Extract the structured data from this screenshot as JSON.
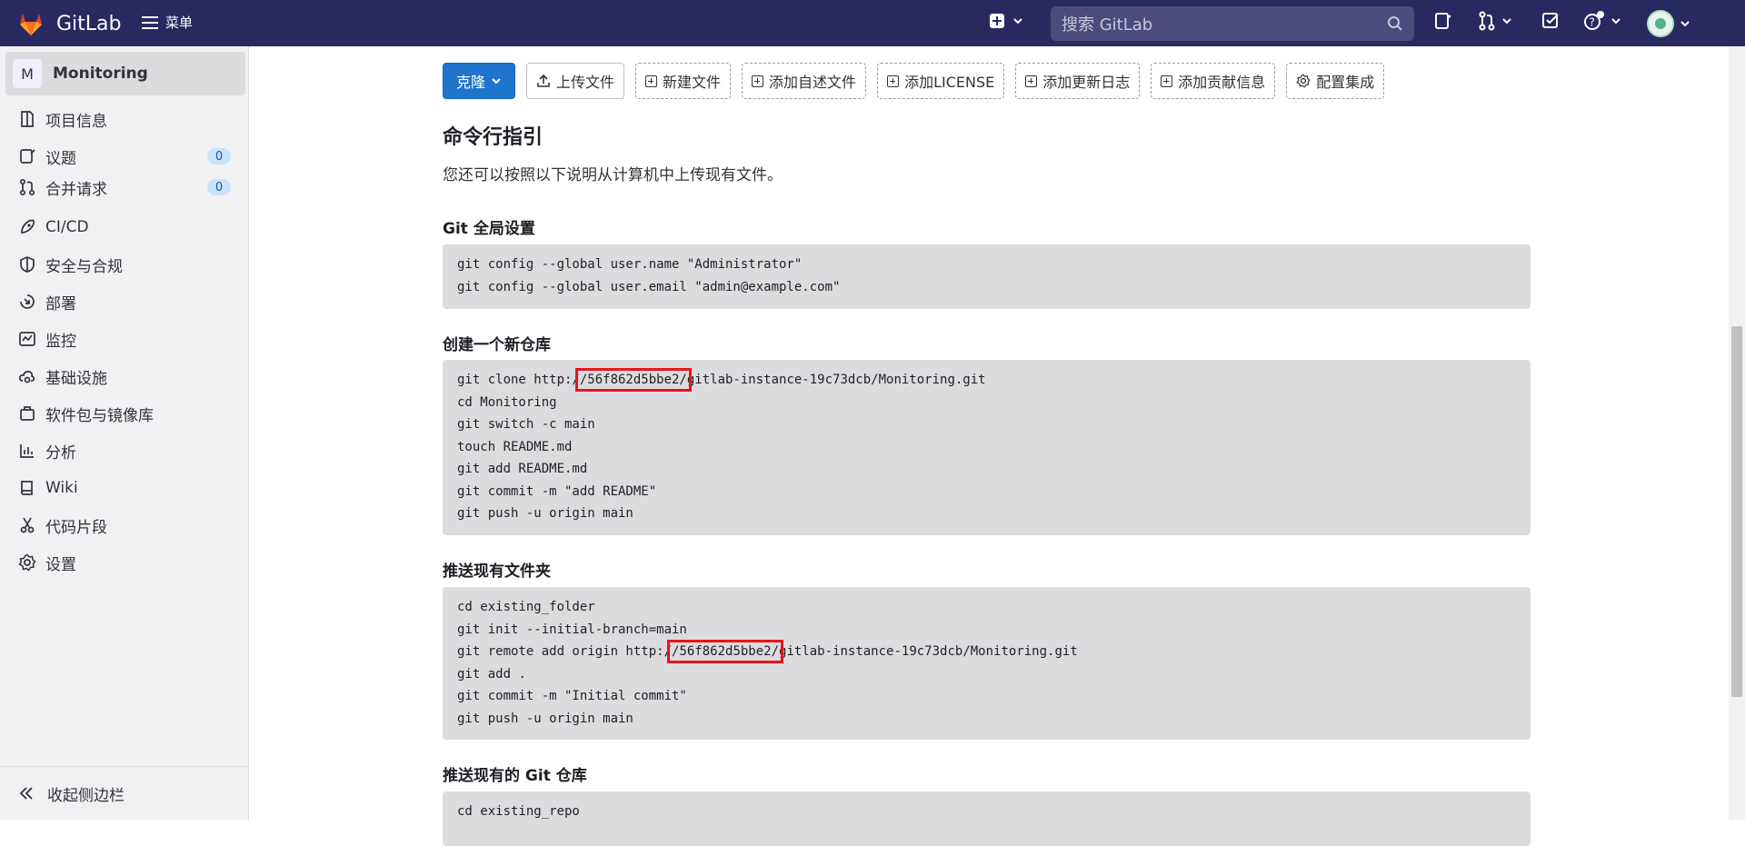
{
  "topbar": {
    "brand": "GitLab",
    "menu_label": "菜单",
    "search_placeholder": "搜索 GitLab"
  },
  "sidebar": {
    "project_initial": "M",
    "project_name": "Monitoring",
    "items": [
      {
        "label": "项目信息",
        "icon": "info-icon"
      },
      {
        "label": "议题",
        "icon": "issues-icon",
        "badge": "0"
      },
      {
        "label": "合并请求",
        "icon": "merge-request-icon",
        "badge": "0"
      },
      {
        "label": "CI/CD",
        "icon": "rocket-icon"
      },
      {
        "label": "安全与合规",
        "icon": "shield-icon"
      },
      {
        "label": "部署",
        "icon": "deploy-icon"
      },
      {
        "label": "监控",
        "icon": "monitor-icon"
      },
      {
        "label": "基础设施",
        "icon": "cloud-gear-icon"
      },
      {
        "label": "软件包与镜像库",
        "icon": "package-icon"
      },
      {
        "label": "分析",
        "icon": "chart-icon"
      },
      {
        "label": "Wiki",
        "icon": "book-icon"
      },
      {
        "label": "代码片段",
        "icon": "scissors-icon"
      },
      {
        "label": "设置",
        "icon": "gear-icon"
      }
    ],
    "collapse_label": "收起侧边栏"
  },
  "toolbar": {
    "clone": "克隆",
    "upload": "上传文件",
    "new_file": "新建文件",
    "add_readme": "添加自述文件",
    "add_license": "添加LICENSE",
    "add_changelog": "添加更新日志",
    "add_contributing": "添加贡献信息",
    "config_integration": "配置集成"
  },
  "content": {
    "title": "命令行指引",
    "description": "您还可以按照以下说明从计算机中上传现有文件。",
    "sections": [
      {
        "title": "Git 全局设置",
        "lines": [
          "git config --global user.name \"Administrator\"",
          "git config --global user.email \"admin@example.com\""
        ]
      },
      {
        "title": "创建一个新仓库",
        "lines": [
          "git clone http://56f862d5bbe2/gitlab-instance-19c73dcb/Monitoring.git",
          "cd Monitoring",
          "git switch -c main",
          "touch README.md",
          "git add README.md",
          "git commit -m \"add README\"",
          "git push -u origin main"
        ]
      },
      {
        "title": "推送现有文件夹",
        "lines": [
          "cd existing_folder",
          "git init --initial-branch=main",
          "git remote add origin http://56f862d5bbe2/gitlab-instance-19c73dcb/Monitoring.git",
          "git add .",
          "git commit -m \"Initial commit\"",
          "git push -u origin main"
        ]
      },
      {
        "title": "推送现有的 Git 仓库",
        "lines": [
          "cd existing_repo"
        ]
      }
    ],
    "clone_prefix": "git clone http:/",
    "clone_host": "/56f862d5bbe2/",
    "clone_suffix": "gitlab-instance-19c73dcb/Monitoring.git",
    "remote_prefix": "git remote add origin http:/",
    "remote_host": "/56f862d5bbe2/",
    "remote_suffix": "gitlab-instance-19c73dcb/Monitoring.git"
  },
  "colors": {
    "topbar": "#292961",
    "primary": "#1f75cb",
    "highlight": "#e8141c"
  }
}
